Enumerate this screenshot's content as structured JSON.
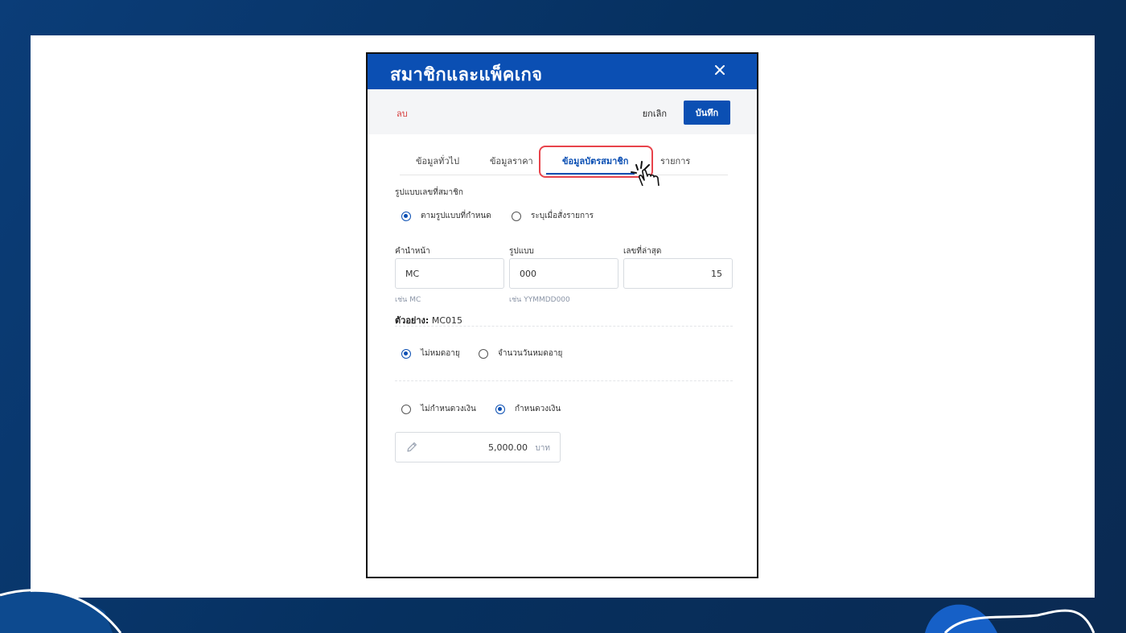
{
  "modal": {
    "title": "สมาชิกและแพ็คเกจ",
    "close_icon": "close-icon"
  },
  "toolbar": {
    "delete_label": "ลบ",
    "cancel_label": "ยกเลิก",
    "save_label": "บันทึก"
  },
  "tabs": [
    {
      "label": "ข้อมูลทั่วไป",
      "active": false
    },
    {
      "label": "ข้อมูลราคา",
      "active": false
    },
    {
      "label": "ข้อมูลบัตรสมาชิก",
      "active": true
    },
    {
      "label": "รายการ",
      "active": false
    }
  ],
  "member_number": {
    "section_label": "รูปแบบเลขที่สมาชิก",
    "options": [
      {
        "label": "ตามรูปแบบที่กำหนด",
        "checked": true
      },
      {
        "label": "ระบุเมื่อสั่งรายการ",
        "checked": false
      }
    ],
    "fields": {
      "prefix": {
        "label": "คำนำหน้า",
        "value": "MC",
        "hint": "เช่น MC"
      },
      "format": {
        "label": "รูปแบบ",
        "value": "000",
        "hint": "เช่น YYMMDD000"
      },
      "last_number": {
        "label": "เลขที่ล่าสุด",
        "value": "15"
      }
    },
    "example_label": "ตัวอย่าง:",
    "example_value": "MC015"
  },
  "expiry": {
    "options": [
      {
        "label": "ไม่หมดอายุ",
        "checked": true
      },
      {
        "label": "จำนวนวันหมดอายุ",
        "checked": false
      }
    ]
  },
  "credit": {
    "options": [
      {
        "label": "ไม่กำหนดวงเงิน",
        "checked": false
      },
      {
        "label": "กำหนดวงเงิน",
        "checked": true
      }
    ],
    "amount_value": "5,000.00",
    "amount_unit": "บาท",
    "edit_icon": "pencil-icon"
  },
  "colors": {
    "primary": "#0b4fb3",
    "danger": "#d63a3a",
    "highlight": "#e8434b",
    "background": "#0b3d78"
  }
}
